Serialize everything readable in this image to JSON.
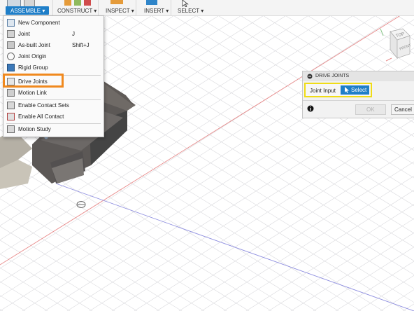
{
  "toolbar": {
    "assemble": "ASSEMBLE ▾",
    "construct": "CONSTRUCT ▾",
    "inspect": "INSPECT ▾",
    "insert": "INSERT ▾",
    "select": "SELECT ▾"
  },
  "menu": {
    "items": [
      {
        "label": "New Component",
        "shortcut": ""
      },
      {
        "label": "Joint",
        "shortcut": "J"
      },
      {
        "label": "As-built Joint",
        "shortcut": "Shift+J"
      },
      {
        "label": "Joint Origin",
        "shortcut": ""
      },
      {
        "label": "Rigid Group",
        "shortcut": ""
      },
      {
        "label": "Drive Joints",
        "shortcut": ""
      },
      {
        "label": "Motion Link",
        "shortcut": ""
      },
      {
        "label": "Enable Contact Sets",
        "shortcut": ""
      },
      {
        "label": "Enable All Contact",
        "shortcut": ""
      },
      {
        "label": "Motion Study",
        "shortcut": ""
      }
    ]
  },
  "dialog": {
    "title": "DRIVE JOINTS",
    "joint_input_label": "Joint Input",
    "select_label": "Select",
    "ok_label": "OK",
    "cancel_label": "Cancel",
    "info_icon": "info-icon"
  },
  "viewcube": {
    "face_top": "TOP",
    "face_front": "FRONT"
  },
  "colors": {
    "accent": "#1e7ec8",
    "menu_highlight": "#f0891e",
    "dialog_highlight": "#f0dc17"
  }
}
